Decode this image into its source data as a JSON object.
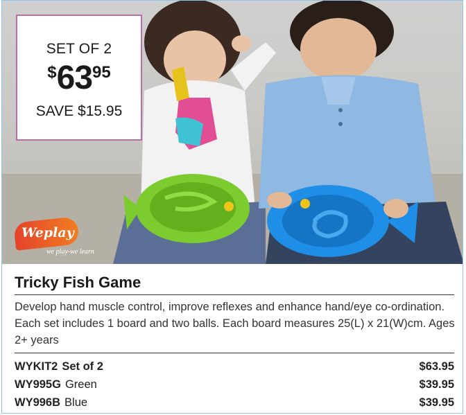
{
  "promo": {
    "set_label": "SET OF 2",
    "currency": "$",
    "dollars": "63",
    "cents": "95",
    "save_text": "SAVE $15.95"
  },
  "brand": {
    "logo_text": "Weplay",
    "tagline": "we play-we learn"
  },
  "product": {
    "title": "Tricky Fish Game",
    "description": "Develop hand muscle control, improve reflexes and enhance hand/eye co-ordination. Each set includes 1 board and two balls. Each board measures 25(L) x 21(W)cm. Ages 2+ years",
    "variants": [
      {
        "code": "WYKIT2",
        "label": "Set of 2",
        "price": "$63.95"
      },
      {
        "code": "WY995G",
        "label": "Green",
        "price": "$39.95"
      },
      {
        "code": "WY996B",
        "label": "Blue",
        "price": "$39.95"
      }
    ]
  },
  "colors": {
    "border": "#8fc3e8",
    "price_box_border": "#b86fa9",
    "green_board": "#7ccb2f",
    "blue_board": "#1f8ee6",
    "logo": "#e4432a"
  }
}
